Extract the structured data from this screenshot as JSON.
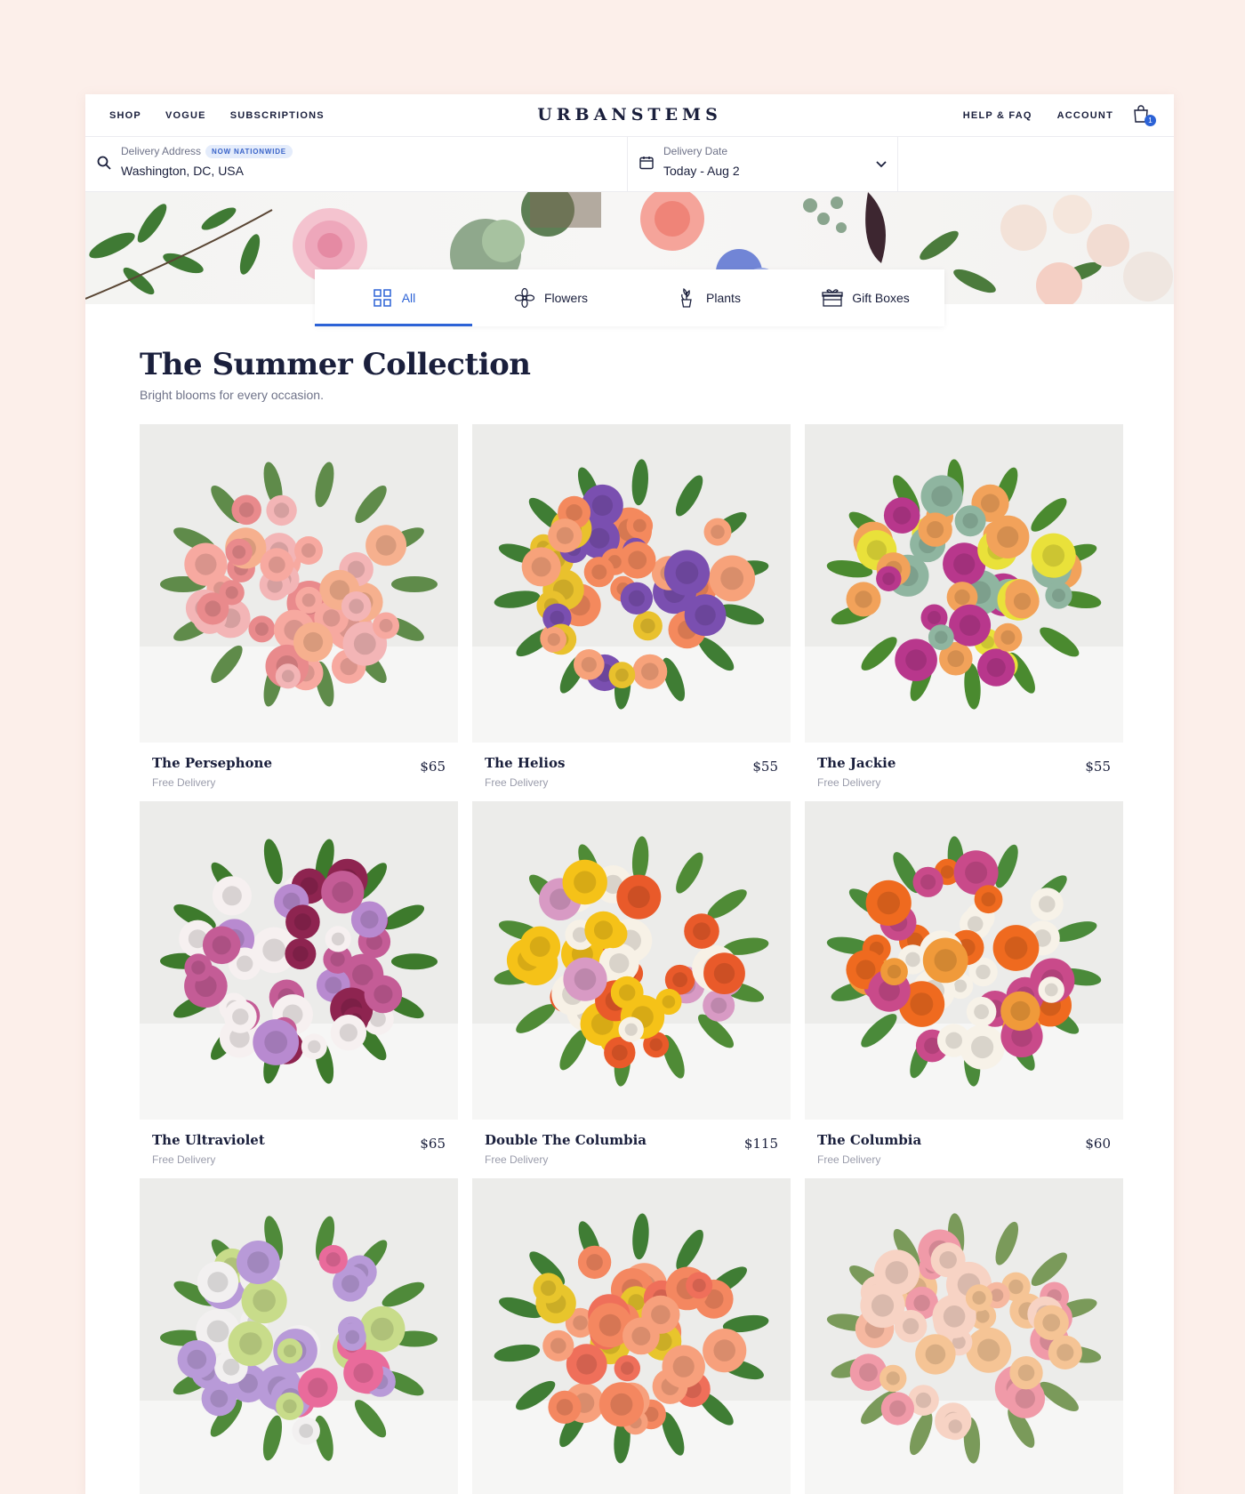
{
  "nav": {
    "left": [
      "SHOP",
      "VOGUE",
      "SUBSCRIPTIONS"
    ],
    "logo": "URBANSTEMS",
    "right": [
      "HELP & FAQ",
      "ACCOUNT"
    ],
    "cart_count": "1"
  },
  "delivery": {
    "address_label": "Delivery Address",
    "address_badge": "NOW NATIONWIDE",
    "address_value": "Washington, DC, USA",
    "date_label": "Delivery Date",
    "date_value": "Today - Aug 2"
  },
  "tabs": [
    {
      "label": "All",
      "icon": "grid-icon",
      "active": true
    },
    {
      "label": "Flowers",
      "icon": "flower-icon",
      "active": false
    },
    {
      "label": "Plants",
      "icon": "plant-icon",
      "active": false
    },
    {
      "label": "Gift Boxes",
      "icon": "gift-box-icon",
      "active": false
    }
  ],
  "collection": {
    "title": "The Summer Collection",
    "subtitle": "Bright blooms for every occasion."
  },
  "products": [
    {
      "name": "The Persephone",
      "price": "$65",
      "delivery": "Free Delivery",
      "palette": [
        "#f7a9a0",
        "#f3b5b6",
        "#f6b08e",
        "#e98a8c"
      ],
      "foliage": "#5f8b4a"
    },
    {
      "name": "The Helios",
      "price": "$55",
      "delivery": "Free Delivery",
      "palette": [
        "#f4895d",
        "#f7a27a",
        "#e9c12d",
        "#7a4fb0"
      ],
      "foliage": "#3f7d34"
    },
    {
      "name": "The Jackie",
      "price": "$55",
      "delivery": "Free Delivery",
      "palette": [
        "#f2a25a",
        "#b8378c",
        "#e9e13a",
        "#8fb5a0"
      ],
      "foliage": "#4a8a2f"
    },
    {
      "name": "The Ultraviolet",
      "price": "$65",
      "delivery": "Free Delivery",
      "palette": [
        "#c45c96",
        "#8e2450",
        "#f6f0f0",
        "#b88ad0"
      ],
      "foliage": "#3d7a2c"
    },
    {
      "name": "Double The Columbia",
      "price": "$115",
      "delivery": "Free Delivery",
      "palette": [
        "#f5c218",
        "#e95a2a",
        "#f7f1e6",
        "#d89ac4"
      ],
      "foliage": "#4f8b36"
    },
    {
      "name": "The Columbia",
      "price": "$60",
      "delivery": "Free Delivery",
      "palette": [
        "#ef6a1f",
        "#f09a3a",
        "#c94a8a",
        "#f7f2e8"
      ],
      "foliage": "#4a8a3a"
    },
    {
      "name": "",
      "price": "",
      "delivery": "",
      "palette": [
        "#e96b9b",
        "#b89ad8",
        "#c8dc8a",
        "#f2f0f0"
      ],
      "foliage": "#4f8a3a"
    },
    {
      "name": "",
      "price": "",
      "delivery": "",
      "palette": [
        "#f48760",
        "#f7a07c",
        "#e8c52c",
        "#ef6f5a"
      ],
      "foliage": "#3f7d34"
    },
    {
      "name": "",
      "price": "",
      "delivery": "",
      "palette": [
        "#f6b8a0",
        "#f09aa8",
        "#f5c495",
        "#f7d3c4"
      ],
      "foliage": "#7a9a5a"
    }
  ]
}
